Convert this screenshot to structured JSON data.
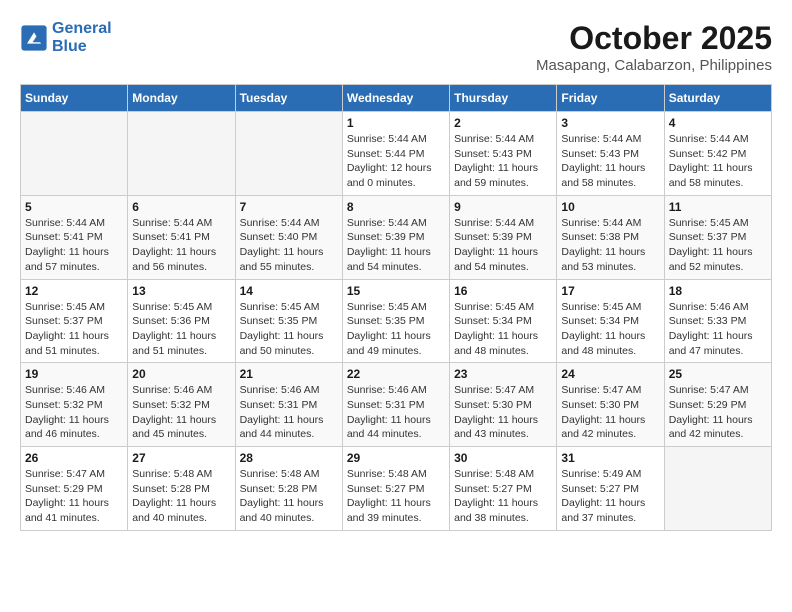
{
  "header": {
    "logo_line1": "General",
    "logo_line2": "Blue",
    "month": "October 2025",
    "location": "Masapang, Calabarzon, Philippines"
  },
  "weekdays": [
    "Sunday",
    "Monday",
    "Tuesday",
    "Wednesday",
    "Thursday",
    "Friday",
    "Saturday"
  ],
  "weeks": [
    [
      {
        "day": "",
        "info": ""
      },
      {
        "day": "",
        "info": ""
      },
      {
        "day": "",
        "info": ""
      },
      {
        "day": "1",
        "info": "Sunrise: 5:44 AM\nSunset: 5:44 PM\nDaylight: 12 hours\nand 0 minutes."
      },
      {
        "day": "2",
        "info": "Sunrise: 5:44 AM\nSunset: 5:43 PM\nDaylight: 11 hours\nand 59 minutes."
      },
      {
        "day": "3",
        "info": "Sunrise: 5:44 AM\nSunset: 5:43 PM\nDaylight: 11 hours\nand 58 minutes."
      },
      {
        "day": "4",
        "info": "Sunrise: 5:44 AM\nSunset: 5:42 PM\nDaylight: 11 hours\nand 58 minutes."
      }
    ],
    [
      {
        "day": "5",
        "info": "Sunrise: 5:44 AM\nSunset: 5:41 PM\nDaylight: 11 hours\nand 57 minutes."
      },
      {
        "day": "6",
        "info": "Sunrise: 5:44 AM\nSunset: 5:41 PM\nDaylight: 11 hours\nand 56 minutes."
      },
      {
        "day": "7",
        "info": "Sunrise: 5:44 AM\nSunset: 5:40 PM\nDaylight: 11 hours\nand 55 minutes."
      },
      {
        "day": "8",
        "info": "Sunrise: 5:44 AM\nSunset: 5:39 PM\nDaylight: 11 hours\nand 54 minutes."
      },
      {
        "day": "9",
        "info": "Sunrise: 5:44 AM\nSunset: 5:39 PM\nDaylight: 11 hours\nand 54 minutes."
      },
      {
        "day": "10",
        "info": "Sunrise: 5:44 AM\nSunset: 5:38 PM\nDaylight: 11 hours\nand 53 minutes."
      },
      {
        "day": "11",
        "info": "Sunrise: 5:45 AM\nSunset: 5:37 PM\nDaylight: 11 hours\nand 52 minutes."
      }
    ],
    [
      {
        "day": "12",
        "info": "Sunrise: 5:45 AM\nSunset: 5:37 PM\nDaylight: 11 hours\nand 51 minutes."
      },
      {
        "day": "13",
        "info": "Sunrise: 5:45 AM\nSunset: 5:36 PM\nDaylight: 11 hours\nand 51 minutes."
      },
      {
        "day": "14",
        "info": "Sunrise: 5:45 AM\nSunset: 5:35 PM\nDaylight: 11 hours\nand 50 minutes."
      },
      {
        "day": "15",
        "info": "Sunrise: 5:45 AM\nSunset: 5:35 PM\nDaylight: 11 hours\nand 49 minutes."
      },
      {
        "day": "16",
        "info": "Sunrise: 5:45 AM\nSunset: 5:34 PM\nDaylight: 11 hours\nand 48 minutes."
      },
      {
        "day": "17",
        "info": "Sunrise: 5:45 AM\nSunset: 5:34 PM\nDaylight: 11 hours\nand 48 minutes."
      },
      {
        "day": "18",
        "info": "Sunrise: 5:46 AM\nSunset: 5:33 PM\nDaylight: 11 hours\nand 47 minutes."
      }
    ],
    [
      {
        "day": "19",
        "info": "Sunrise: 5:46 AM\nSunset: 5:32 PM\nDaylight: 11 hours\nand 46 minutes."
      },
      {
        "day": "20",
        "info": "Sunrise: 5:46 AM\nSunset: 5:32 PM\nDaylight: 11 hours\nand 45 minutes."
      },
      {
        "day": "21",
        "info": "Sunrise: 5:46 AM\nSunset: 5:31 PM\nDaylight: 11 hours\nand 44 minutes."
      },
      {
        "day": "22",
        "info": "Sunrise: 5:46 AM\nSunset: 5:31 PM\nDaylight: 11 hours\nand 44 minutes."
      },
      {
        "day": "23",
        "info": "Sunrise: 5:47 AM\nSunset: 5:30 PM\nDaylight: 11 hours\nand 43 minutes."
      },
      {
        "day": "24",
        "info": "Sunrise: 5:47 AM\nSunset: 5:30 PM\nDaylight: 11 hours\nand 42 minutes."
      },
      {
        "day": "25",
        "info": "Sunrise: 5:47 AM\nSunset: 5:29 PM\nDaylight: 11 hours\nand 42 minutes."
      }
    ],
    [
      {
        "day": "26",
        "info": "Sunrise: 5:47 AM\nSunset: 5:29 PM\nDaylight: 11 hours\nand 41 minutes."
      },
      {
        "day": "27",
        "info": "Sunrise: 5:48 AM\nSunset: 5:28 PM\nDaylight: 11 hours\nand 40 minutes."
      },
      {
        "day": "28",
        "info": "Sunrise: 5:48 AM\nSunset: 5:28 PM\nDaylight: 11 hours\nand 40 minutes."
      },
      {
        "day": "29",
        "info": "Sunrise: 5:48 AM\nSunset: 5:27 PM\nDaylight: 11 hours\nand 39 minutes."
      },
      {
        "day": "30",
        "info": "Sunrise: 5:48 AM\nSunset: 5:27 PM\nDaylight: 11 hours\nand 38 minutes."
      },
      {
        "day": "31",
        "info": "Sunrise: 5:49 AM\nSunset: 5:27 PM\nDaylight: 11 hours\nand 37 minutes."
      },
      {
        "day": "",
        "info": ""
      }
    ]
  ]
}
